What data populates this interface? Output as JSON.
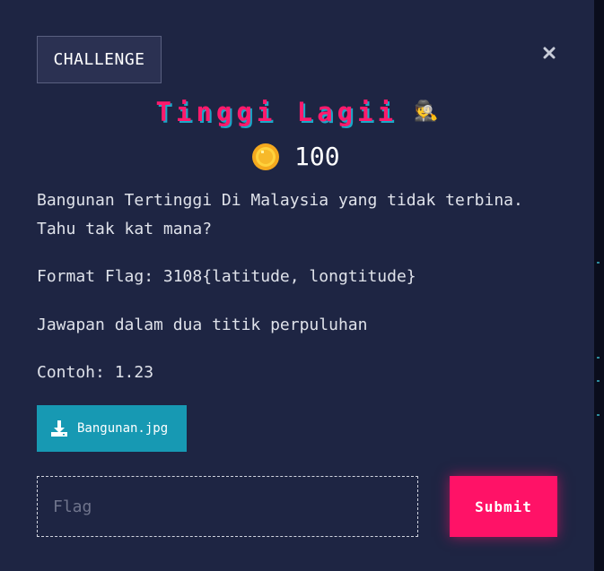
{
  "modal": {
    "tab_label": "CHALLENGE",
    "close_icon": "close-icon",
    "title": "Tinggi Lagii",
    "title_emoji": "🕵",
    "points": "100",
    "coin_icon": "coin-icon",
    "description": [
      "Bangunan Tertinggi Di Malaysia yang tidak terbina.",
      "Tahu tak kat mana?",
      "Format Flag: 3108{latitude, longtitude}",
      "Jawapan dalam dua titik perpuluhan",
      "Contoh: 1.23"
    ],
    "attachment": {
      "icon": "download-icon",
      "label": "Bangunan.jpg"
    },
    "flag_input": {
      "placeholder": "Flag",
      "value": ""
    },
    "submit_label": "Submit"
  },
  "colors": {
    "background": "#1e2543",
    "title": "#ff1a6c",
    "title_shadow": "#1aa8c9",
    "download_button": "#1799b3",
    "submit_button": "#ff1267"
  }
}
